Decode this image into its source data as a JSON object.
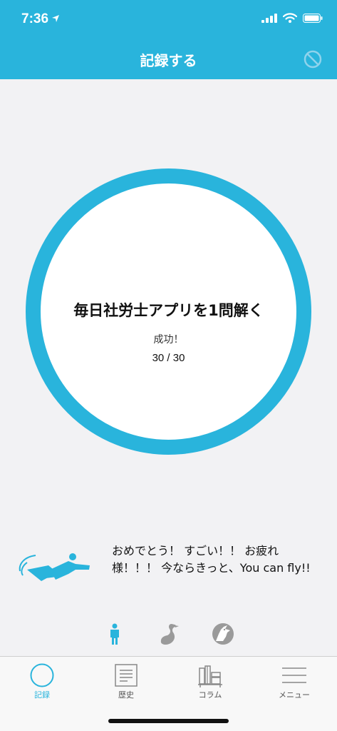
{
  "status_bar": {
    "time": "7:36"
  },
  "nav": {
    "title": "記録する",
    "cancel_icon": "cancel-circle-icon"
  },
  "challenge": {
    "title": "毎日社労士アプリを1問解く",
    "status": "成功！",
    "progress": "30 / 30",
    "progress_fraction": 1.0,
    "ring_color": "#29b4dc"
  },
  "cheer": {
    "message": "おめでとう！ すごい！！ お疲れ様！！！ 今ならきっと、You can fly!!",
    "character_icon": "flying-person-icon"
  },
  "characters": [
    {
      "icon": "person-icon",
      "selected": true
    },
    {
      "icon": "bird-icon",
      "selected": false
    },
    {
      "icon": "wolf-icon",
      "selected": false
    }
  ],
  "tabs": [
    {
      "label": "記録",
      "icon": "circle-icon",
      "active": true
    },
    {
      "label": "歴史",
      "icon": "document-icon",
      "active": false
    },
    {
      "label": "コラム",
      "icon": "bookshelf-icon",
      "active": false
    },
    {
      "label": "メニュー",
      "icon": "menu-icon",
      "active": false
    }
  ],
  "colors": {
    "accent": "#29b4dc",
    "background": "#f2f2f4",
    "inactive": "#9a9a9a"
  }
}
